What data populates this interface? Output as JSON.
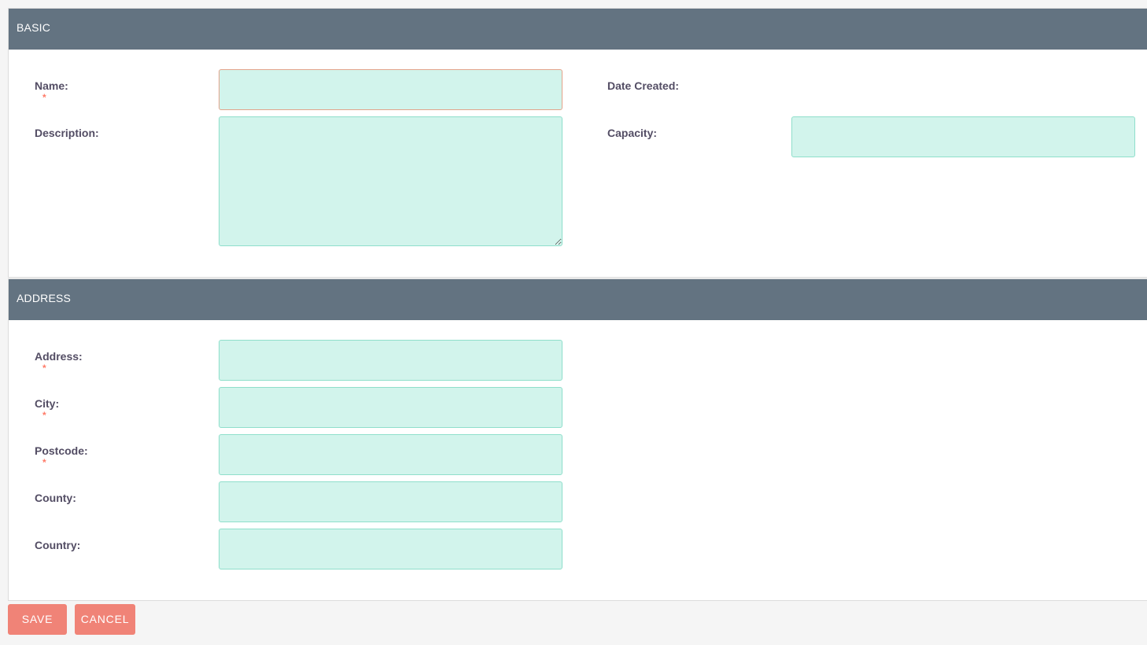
{
  "sections": {
    "basic": {
      "title": "BASIC",
      "fields": {
        "name": {
          "label": "Name:",
          "required": "*",
          "value": ""
        },
        "description": {
          "label": "Description:",
          "value": ""
        },
        "date_created": {
          "label": "Date Created:",
          "value": ""
        },
        "capacity": {
          "label": "Capacity:",
          "value": ""
        }
      }
    },
    "address": {
      "title": "ADDRESS",
      "fields": {
        "address": {
          "label": "Address:",
          "required": "*",
          "value": ""
        },
        "city": {
          "label": "City:",
          "required": "*",
          "value": ""
        },
        "postcode": {
          "label": "Postcode:",
          "required": "*",
          "value": ""
        },
        "county": {
          "label": "County:",
          "value": ""
        },
        "country": {
          "label": "Country:",
          "value": ""
        }
      }
    }
  },
  "actions": {
    "save_label": "SAVE",
    "cancel_label": "CANCEL"
  },
  "colors": {
    "header_bg": "#637381",
    "input_bg": "#d2f4ec",
    "input_border": "#8fdfcb",
    "button_bg": "#f08377",
    "required_mark": "#ff7b68"
  }
}
